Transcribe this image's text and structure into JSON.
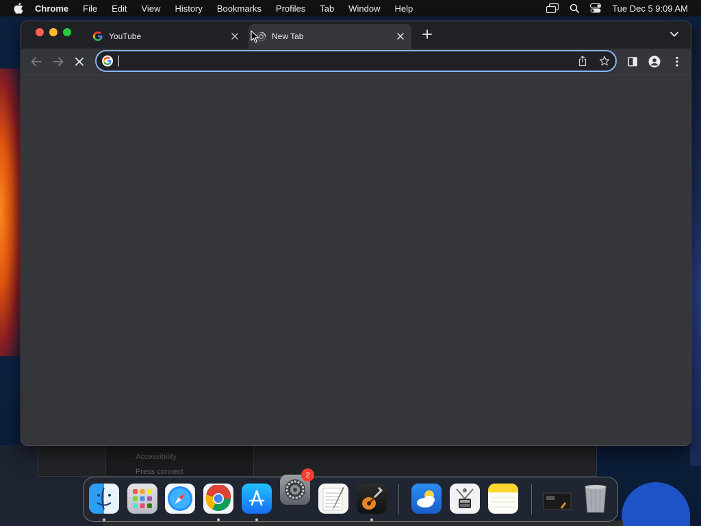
{
  "menubar": {
    "app_name": "Chrome",
    "items": [
      "File",
      "Edit",
      "View",
      "History",
      "Bookmarks",
      "Profiles",
      "Tab",
      "Window",
      "Help"
    ],
    "clock": "Tue Dec 5  9:09 AM",
    "status_icons": [
      "screen-mirroring-icon",
      "spotlight-search-icon",
      "control-center-icon"
    ]
  },
  "browser": {
    "tabs": [
      {
        "title": "YouTube",
        "favicon": "google-icon",
        "active": false
      },
      {
        "title": "New Tab",
        "favicon": "loading-icon",
        "active": true
      }
    ],
    "omnibox": {
      "value": "",
      "placeholder": ""
    },
    "colors": {
      "frame": "#202124",
      "toolbar": "#35363a",
      "focus_ring": "#8ab4f8"
    }
  },
  "background_window": {
    "line1": "Accessibility",
    "line2": "Press connect"
  },
  "dock": {
    "apps": [
      {
        "name": "Finder",
        "icon": "finder-icon",
        "running": true
      },
      {
        "name": "Launchpad",
        "icon": "launchpad-icon",
        "running": false
      },
      {
        "name": "Safari",
        "icon": "safari-icon",
        "running": false
      },
      {
        "name": "Google Chrome",
        "icon": "chrome-icon",
        "running": true
      },
      {
        "name": "App Store",
        "icon": "app-store-icon",
        "running": true
      },
      {
        "name": "System Settings",
        "icon": "system-settings-icon",
        "running": false
      },
      {
        "name": "TextEdit",
        "icon": "textedit-icon",
        "running": false
      },
      {
        "name": "GarageBand",
        "icon": "garageband-icon",
        "running": true
      },
      {
        "name": "Weather",
        "icon": "weather-icon",
        "running": false
      },
      {
        "name": "System Information",
        "icon": "system-information-icon",
        "running": false
      },
      {
        "name": "Notes",
        "icon": "notes-icon",
        "running": false
      },
      {
        "name": "Screenshot Folder",
        "icon": "folder-stack-icon",
        "running": false
      },
      {
        "name": "Trash",
        "icon": "trash-icon",
        "running": false
      }
    ],
    "settings_badge": "2"
  }
}
